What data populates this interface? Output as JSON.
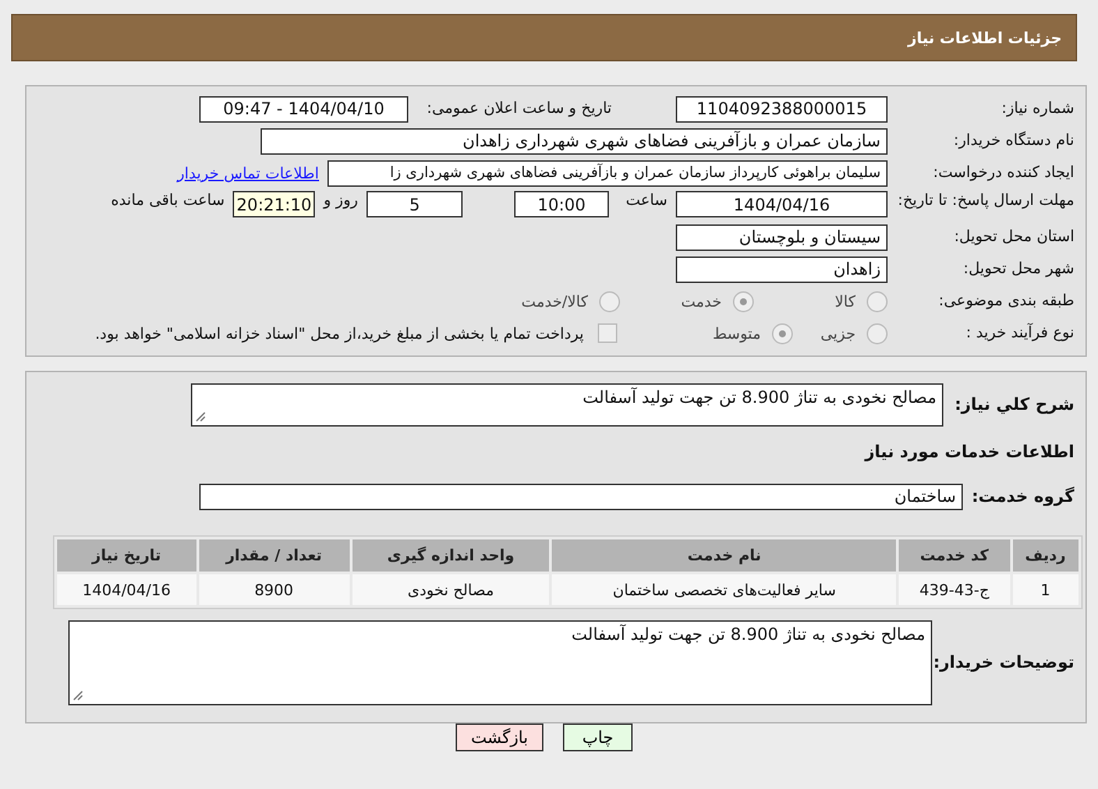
{
  "header": {
    "title": "جزئیات اطلاعات نیاز"
  },
  "need_number": {
    "label": "شماره نیاز:",
    "value": "1104092388000015"
  },
  "announce": {
    "label": "تاریخ و ساعت اعلان عمومی:",
    "value": "1404/04/10 - 09:47"
  },
  "buyer_org": {
    "label": "نام دستگاه خریدار:",
    "value": "سازمان عمران و بازآفرینی فضاهای شهری شهرداری زاهدان"
  },
  "requester": {
    "label": "ایجاد کننده درخواست:",
    "value": "سلیمان براهوئی کارپرداز سازمان عمران و بازآفرینی فضاهای شهری شهرداری زا",
    "link": "اطلاعات تماس خریدار"
  },
  "deadline": {
    "label": "مهلت ارسال پاسخ: تا تاریخ:",
    "date": "1404/04/16",
    "time_label": "ساعت",
    "time": "10:00",
    "days": "5",
    "days_label": "روز و",
    "remaining": "20:21:10",
    "remaining_label": "ساعت باقی مانده"
  },
  "province": {
    "label": "استان محل تحویل:",
    "value": "سیستان و بلوچستان"
  },
  "city": {
    "label": "شهر محل تحویل:",
    "value": "زاهدان"
  },
  "category": {
    "label": "طبقه بندی موضوعی:",
    "options": [
      {
        "label": "کالا",
        "selected": false
      },
      {
        "label": "خدمت",
        "selected": true
      },
      {
        "label": "کالا/خدمت",
        "selected": false
      }
    ]
  },
  "purchase_process": {
    "label": "نوع فرآیند خرید :",
    "options": [
      {
        "label": "جزیی",
        "selected": false
      },
      {
        "label": "متوسط",
        "selected": true
      }
    ],
    "payment": {
      "label": "پرداخت تمام یا بخشی از مبلغ خرید،از محل \"اسناد خزانه اسلامی\" خواهد بود.",
      "checked": false
    }
  },
  "description": {
    "label": "شرح کلي نیاز:",
    "value": "مصالح نخودی به تناژ 8.900 تن جهت تولید آسفالت"
  },
  "services_heading": "اطلاعات خدمات مورد نیاز",
  "service_group": {
    "label": "گروه خدمت:",
    "value": "ساختمان"
  },
  "table": {
    "columns": [
      "ردیف",
      "کد خدمت",
      "نام خدمت",
      "واحد اندازه گیری",
      "تعداد / مقدار",
      "تاریخ نیاز"
    ],
    "rows": [
      [
        "1",
        "ج-43-439",
        "سایر فعالیت‌های تخصصی ساختمان",
        "مصالح نخودی",
        "8900",
        "1404/04/16"
      ]
    ]
  },
  "buyer_notes": {
    "label": "توضیحات خریدار:",
    "value": "مصالح نخودی به تناژ 8.900 تن جهت تولید آسفالت"
  },
  "buttons": [
    {
      "label": "چاپ",
      "kind": "print"
    },
    {
      "label": "بازگشت",
      "kind": "back"
    }
  ]
}
